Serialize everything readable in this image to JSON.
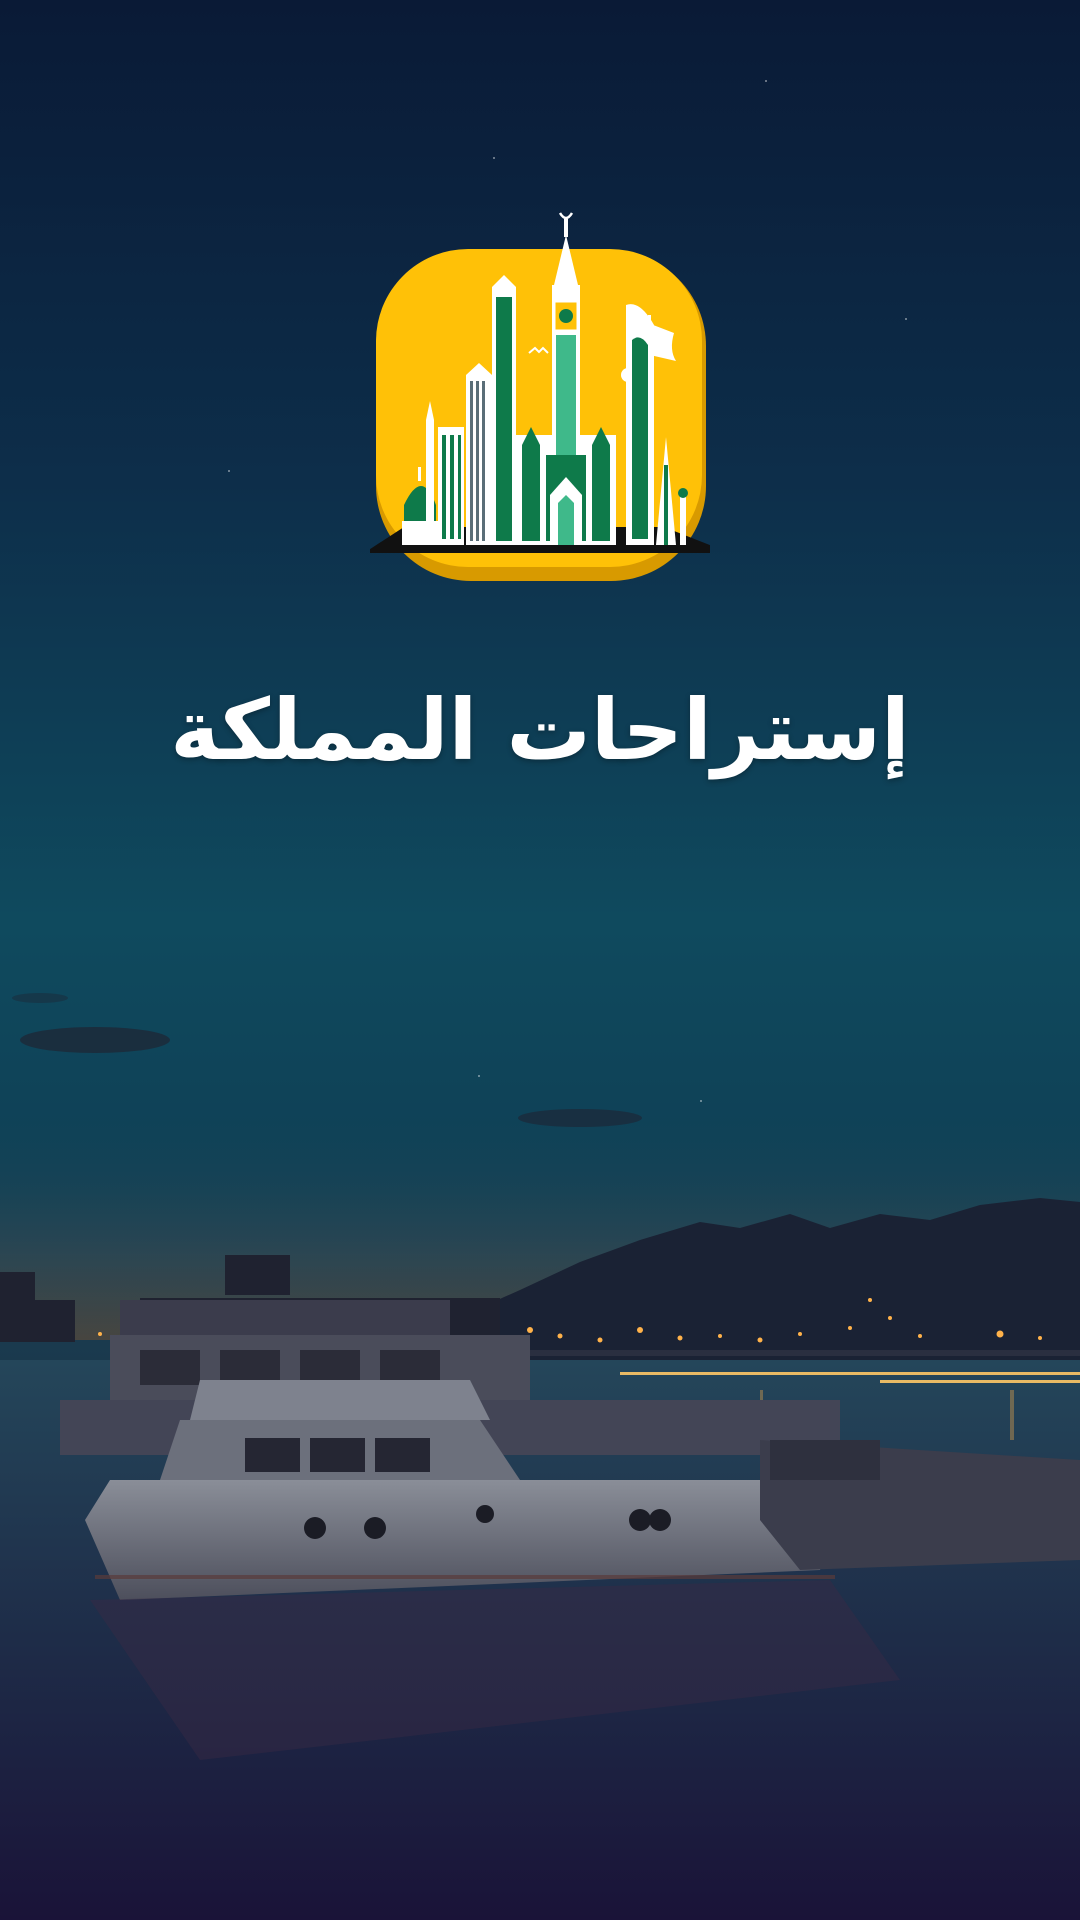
{
  "app": {
    "title": "إستراحات المملكة"
  },
  "logo": {
    "icon": "saudi-skyline-icon",
    "background_color": "#FFC107",
    "accent_color": "#0E7A4A"
  },
  "background": {
    "scene": "harbor-night-background",
    "sky_top_color": "#0A1A36",
    "sky_mid_color": "#0F4A5E",
    "bottom_color": "#1A1338"
  }
}
